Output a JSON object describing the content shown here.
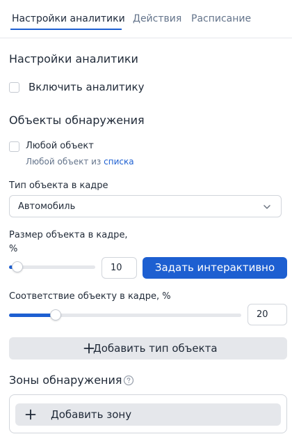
{
  "tabs": [
    {
      "label": "Настройки аналитики",
      "active": true
    },
    {
      "label": "Действия",
      "active": false
    },
    {
      "label": "Расписание",
      "active": false
    }
  ],
  "analytics": {
    "heading": "Настройки аналитики",
    "enable_label": "Включить аналитику",
    "enabled": false
  },
  "detection_objects": {
    "heading": "Объекты обнаружения",
    "any_object_label": "Любой объект",
    "any_object_checked": false,
    "hint_prefix": "Любой объект из",
    "hint_link": "списка",
    "type_label": "Тип объекта в кадре",
    "type_value": "Автомобиль",
    "size_label_line1": "Размер объекта в кадре,",
    "size_label_line2": "%",
    "size_value": "10",
    "size_fraction": 0.1,
    "set_interactive_label": "Задать интерактивно",
    "match_label": "Соответствие объекту в кадре, %",
    "match_value": "20",
    "match_fraction": 0.2,
    "add_type_label": "Добавить тип объекта"
  },
  "zones": {
    "heading": "Зоны обнаружения",
    "add_zone_label": "Добавить зону"
  },
  "colors": {
    "accent": "#1d5fd1",
    "muted": "#64748b",
    "button_gray": "#e5e7eb"
  },
  "icons": [
    "chevron-down-icon",
    "plus-icon",
    "help-icon"
  ]
}
